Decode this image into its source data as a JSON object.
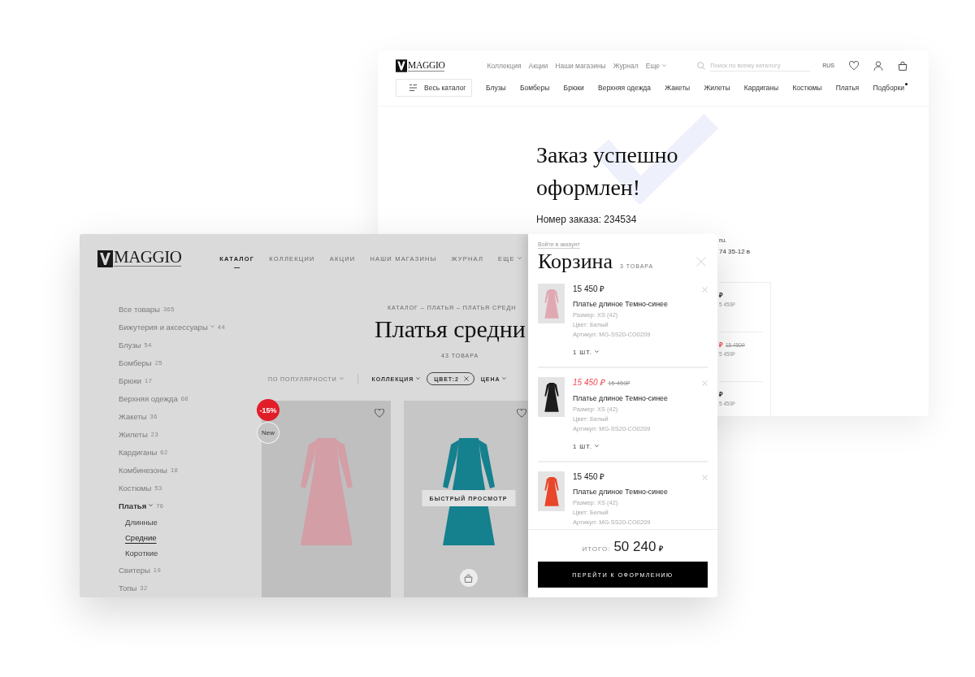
{
  "order_window": {
    "logo": "MAGGIO",
    "nav": [
      {
        "label": "Коллекция",
        "dropdown": false
      },
      {
        "label": "Акции",
        "dropdown": false
      },
      {
        "label": "Наши магазины",
        "dropdown": false
      },
      {
        "label": "Журнал",
        "dropdown": false
      },
      {
        "label": "Еще",
        "dropdown": true
      }
    ],
    "search": {
      "placeholder": "Поиск по всему каталогу"
    },
    "language": "RUS",
    "catalog_button": "Весь каталог",
    "categories": [
      {
        "label": "Блузы",
        "marked": false
      },
      {
        "label": "Бомберы",
        "marked": false
      },
      {
        "label": "Брюки",
        "marked": false
      },
      {
        "label": "Верхняя одежда",
        "marked": false
      },
      {
        "label": "Жакеты",
        "marked": false
      },
      {
        "label": "Жилеты",
        "marked": false
      },
      {
        "label": "Кардиганы",
        "marked": false
      },
      {
        "label": "Костюмы",
        "marked": false
      },
      {
        "label": "Платья",
        "marked": false
      },
      {
        "label": "Подборки",
        "marked": true
      }
    ],
    "title": "Заказ успешно оформлен!",
    "order_number": "Номер заказа: 234534",
    "text_fragments": [
      "ru.",
      "74 35-12 в"
    ],
    "summary_rows": [
      {
        "price": "₽",
        "total": "5 450₽"
      },
      {
        "price": "₽",
        "old_price": "15 450₽",
        "total": "5 450₽"
      },
      {
        "price": "₽",
        "total": "5 450₽"
      }
    ]
  },
  "catalog_window": {
    "logo": "MAGGIO",
    "nav": [
      {
        "label": "КАТАЛОГ",
        "selected": true,
        "dropdown": false
      },
      {
        "label": "КОЛЛЕКЦИИ",
        "selected": false,
        "dropdown": false
      },
      {
        "label": "АКЦИИ",
        "selected": false,
        "dropdown": false
      },
      {
        "label": "НАШИ МАГАЗИНЫ",
        "selected": false,
        "dropdown": false
      },
      {
        "label": "ЖУРНАЛ",
        "selected": false,
        "dropdown": false
      },
      {
        "label": "ЕЩЕ",
        "selected": false,
        "dropdown": true
      }
    ],
    "sidebar": [
      {
        "label": "Все товары",
        "count": "365",
        "expandable": false,
        "expanded": false
      },
      {
        "label": "Бижутерия и аксессуары",
        "count": "44",
        "expandable": true,
        "expanded": false
      },
      {
        "label": "Блузы",
        "count": "54",
        "expandable": false,
        "expanded": false
      },
      {
        "label": "Бомберы",
        "count": "25",
        "expandable": false,
        "expanded": false
      },
      {
        "label": "Брюки",
        "count": "17",
        "expandable": false,
        "expanded": false
      },
      {
        "label": "Верхняя одежда",
        "count": "68",
        "expandable": false,
        "expanded": false
      },
      {
        "label": "Жакеты",
        "count": "36",
        "expandable": false,
        "expanded": false
      },
      {
        "label": "Жилеты",
        "count": "23",
        "expandable": false,
        "expanded": false
      },
      {
        "label": "Кардиганы",
        "count": "62",
        "expandable": false,
        "expanded": false
      },
      {
        "label": "Комбинезоны",
        "count": "18",
        "expandable": false,
        "expanded": false
      },
      {
        "label": "Костюмы",
        "count": "53",
        "expandable": false,
        "expanded": false
      },
      {
        "label": "Платья",
        "count": "76",
        "expandable": true,
        "expanded": true,
        "children": [
          {
            "label": "Длинные",
            "selected": false
          },
          {
            "label": "Средние",
            "selected": true
          },
          {
            "label": "Короткие",
            "selected": false
          }
        ]
      },
      {
        "label": "Свитеры",
        "count": "19",
        "expandable": false,
        "expanded": false
      },
      {
        "label": "Топы",
        "count": "32",
        "expandable": false,
        "expanded": false
      }
    ],
    "breadcrumb": "КАТАЛОГ – ПЛАТЬЯ – ПЛАТЬЯ СРЕДН",
    "title": "Платья средни",
    "count": "43 ТОВАРА",
    "filters": [
      {
        "kind": "sort",
        "label": "ПО ПОПУЛЯРНОСТИ"
      },
      {
        "kind": "dropdown",
        "label": "КОЛЛЕКЦИЯ"
      },
      {
        "kind": "chip",
        "label": "ЦВЕТ:2"
      },
      {
        "kind": "dropdown",
        "label": "ЦЕНА"
      }
    ],
    "products": [
      {
        "color": "#d39ea6",
        "favorite": false,
        "hovered": false,
        "badges": [
          {
            "kind": "discount",
            "text": "-15%"
          },
          {
            "kind": "new",
            "text": "New"
          }
        ]
      },
      {
        "color": "#15808e",
        "favorite": false,
        "hovered": true,
        "quick_view": "БЫСТРЫЙ ПРОСМОТР"
      }
    ]
  },
  "cart": {
    "login_link": "Войти в аккаунт",
    "title": "Корзина",
    "count": "3 ТОВАРА",
    "items": [
      {
        "color": "#e0a9b2",
        "price": "15 450 ₽",
        "name": "Платье длиное Темно-синее",
        "size": "Размер: XS (42)",
        "color_text": "Цвет: Белый",
        "sku": "Артикул: MG-SS20-CO0209",
        "quantity": "1 ШТ."
      },
      {
        "color": "#1c1c1c",
        "price": "15 450 ₽",
        "old_price": "15 450₽",
        "name": "Платье длиное Темно-синее",
        "size": "Размер: XS (42)",
        "color_text": "Цвет: Белый",
        "sku": "Артикул: MG-SS20-CO0209",
        "quantity": "1 ШТ."
      },
      {
        "color": "#e8452a",
        "price": "15 450 ₽",
        "name": "Платье длиное Темно-синее",
        "size": "Размер: XS (42)",
        "color_text": "Цвет: Белый",
        "sku": "Артикул: MG-SS20-CO0209"
      }
    ],
    "total_label": "ИТОГО:",
    "total": "50 240",
    "currency": "₽",
    "checkout_button": "ПЕРЕЙТИ К ОФОРМЛЕНИЮ"
  }
}
